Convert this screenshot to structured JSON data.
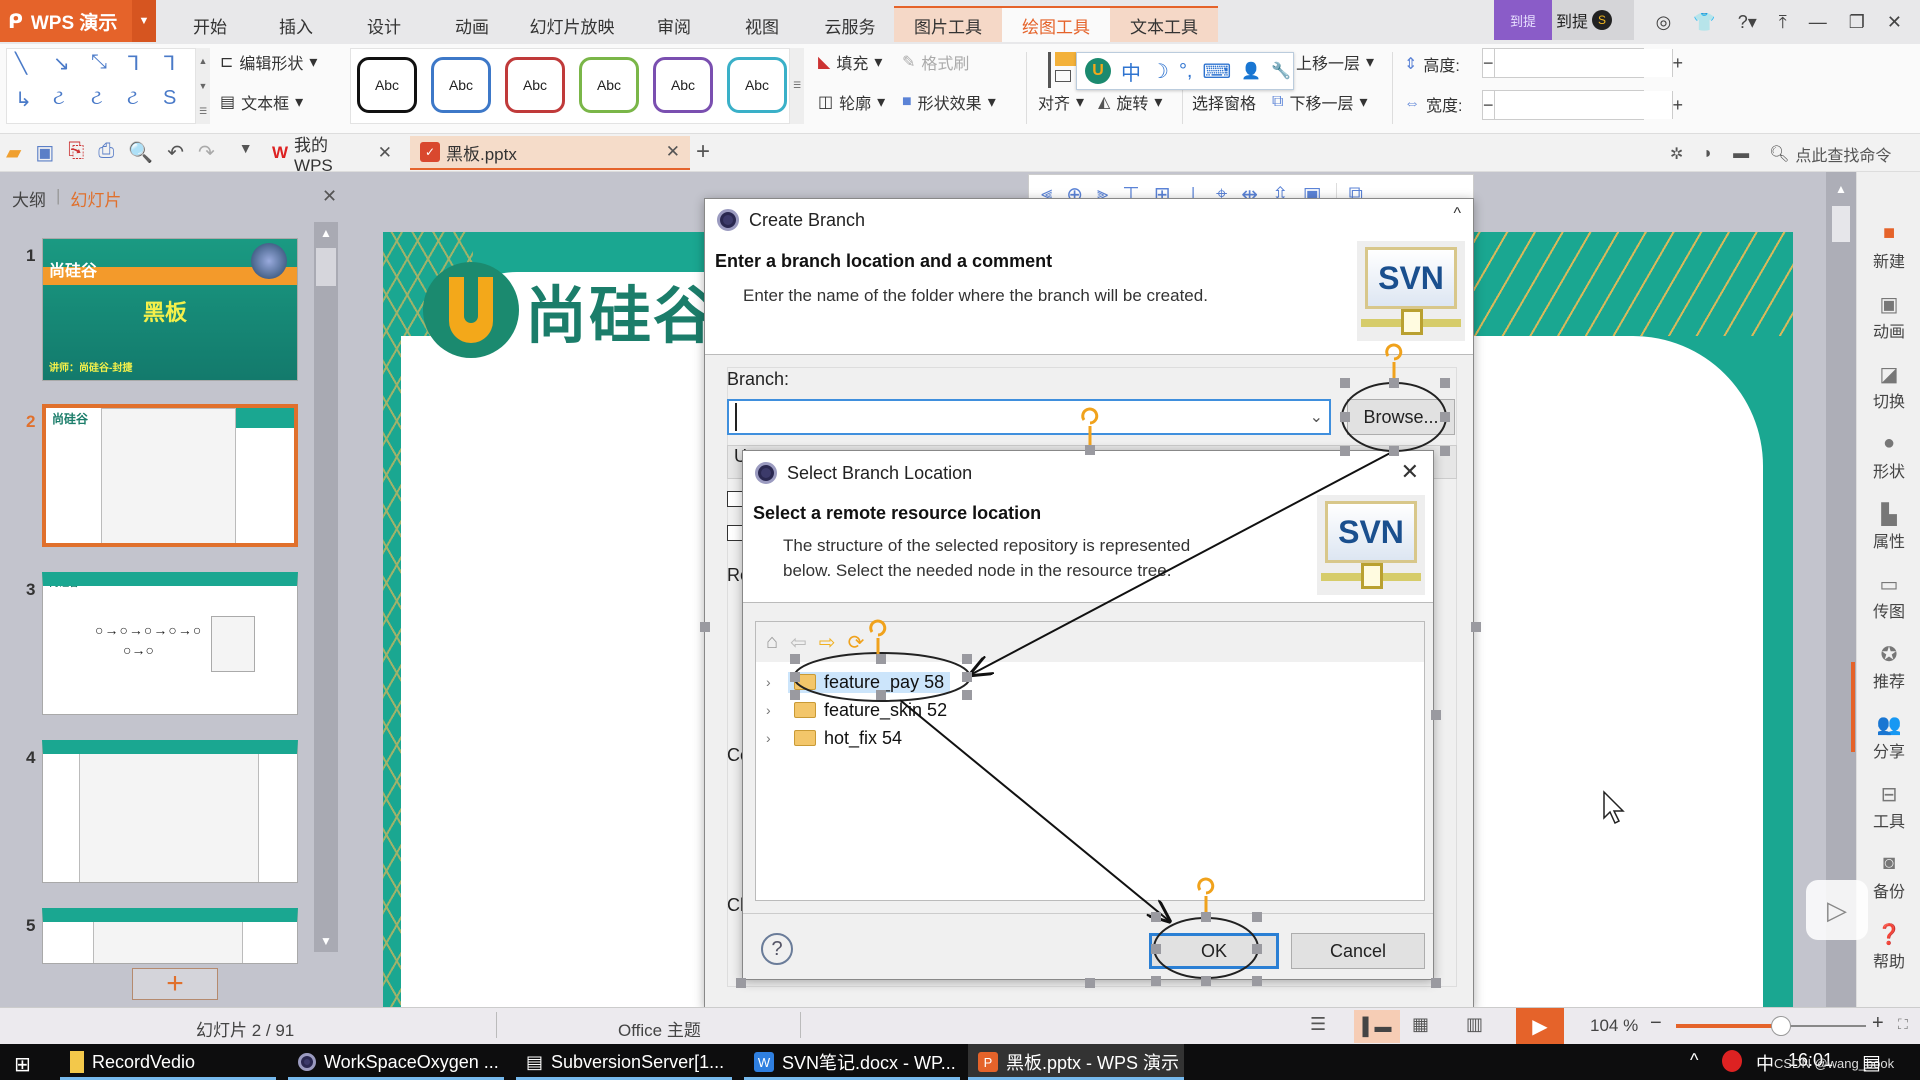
{
  "app": {
    "name": "WPS 演示",
    "logo_icon": "wps-presentation-icon"
  },
  "menu": {
    "tabs": [
      "开始",
      "插入",
      "设计",
      "动画",
      "幻灯片放映",
      "审阅",
      "视图",
      "云服务"
    ],
    "context_tabs": [
      "图片工具",
      "绘图工具",
      "文本工具"
    ],
    "active_tab": "绘图工具"
  },
  "titlebar": {
    "user_badge": "到提",
    "user_name": "到提",
    "coin_icon": "S"
  },
  "ribbon": {
    "edit_shape": "编辑形状",
    "text_box": "文本框",
    "style_label": "Abc",
    "style_colors": [
      "#111111",
      "#3d78c8",
      "#c03a3a",
      "#7ab648",
      "#7a4fb0",
      "#3ab0c8"
    ],
    "fill": "填充",
    "format_painter": "格式刷",
    "outline": "轮廓",
    "shape_effects": "形状效果",
    "align": "对齐",
    "rotate": "旋转",
    "selection_pane": "选择窗格",
    "bring_forward": "上移一层",
    "send_backward": "下移一层",
    "height_label": "高度:",
    "width_label": "宽度:",
    "height_value": "",
    "width_value": "",
    "minus": "−",
    "plus": "+"
  },
  "ime": {
    "mode": "中",
    "symbols": [
      "☽",
      "°,",
      "⌨",
      "👤",
      "🔧"
    ]
  },
  "quickbar": {
    "doc_tabs": [
      {
        "label": "我的WPS",
        "icon": "wps-home-icon"
      },
      {
        "label": "黑板.pptx",
        "icon": "pptx-file-icon",
        "active": true
      }
    ],
    "new_tab": "+",
    "search_placeholder": "点此查找命令"
  },
  "left_panel": {
    "tabs": [
      "大纲",
      "幻灯片"
    ],
    "active_tab": "幻灯片",
    "slides": [
      {
        "num": "1",
        "title": "黑板",
        "subtitle": "讲师：尚硅谷-封捷"
      },
      {
        "num": "2",
        "selected": true
      },
      {
        "num": "3"
      },
      {
        "num": "4"
      },
      {
        "num": "5"
      }
    ],
    "logo_text": "尚硅谷"
  },
  "slide": {
    "logo_text": "尚硅谷"
  },
  "align_toolbar": {
    "icons": [
      "align-left-icon",
      "align-center-icon",
      "align-right-icon",
      "align-top-icon",
      "align-middle-icon",
      "align-bottom-icon",
      "align-canvas-center-icon",
      "distribute-horizontal-icon",
      "distribute-vertical-icon",
      "group-icon",
      "arrange-icon"
    ]
  },
  "create_branch": {
    "title": "Create Branch",
    "heading": "Enter a branch location and a comment",
    "description": "Enter the name of the folder where the branch will be created.",
    "branch_label": "Branch:",
    "branch_value": "",
    "browse_button": "Browse...",
    "partial_labels": [
      "U",
      "Re",
      "Co",
      "Ch"
    ]
  },
  "select_branch": {
    "title": "Select Branch Location",
    "heading": "Select a remote resource location",
    "description_line1": "The structure of the selected repository is represented",
    "description_line2": "below. Select the needed node in the resource tree.",
    "tree": [
      {
        "label": "feature_pay 58",
        "selected": true
      },
      {
        "label": "feature_skin 52"
      },
      {
        "label": "hot_fix 54"
      }
    ],
    "ok_button": "OK",
    "cancel_button": "Cancel",
    "help_icon": "?"
  },
  "svn_logo": "SVN",
  "right_sidebar": {
    "items": [
      "新建",
      "动画",
      "切换",
      "形状",
      "属性",
      "传图",
      "推荐",
      "分享",
      "工具",
      "备份",
      "帮助"
    ]
  },
  "statusbar": {
    "slide_info": "幻灯片 2 / 91",
    "theme": "Office 主题",
    "zoom": "104 %",
    "zoom_fraction": 0.55
  },
  "taskbar": {
    "items": [
      "RecordVedio",
      "WorkSpaceOxygen ...",
      "SubversionServer[1...",
      "SVN笔记.docx - WP...",
      "黑板.pptx - WPS 演示"
    ],
    "ime": "中",
    "time": "16:01",
    "watermark": "CSDN @wang_book"
  }
}
